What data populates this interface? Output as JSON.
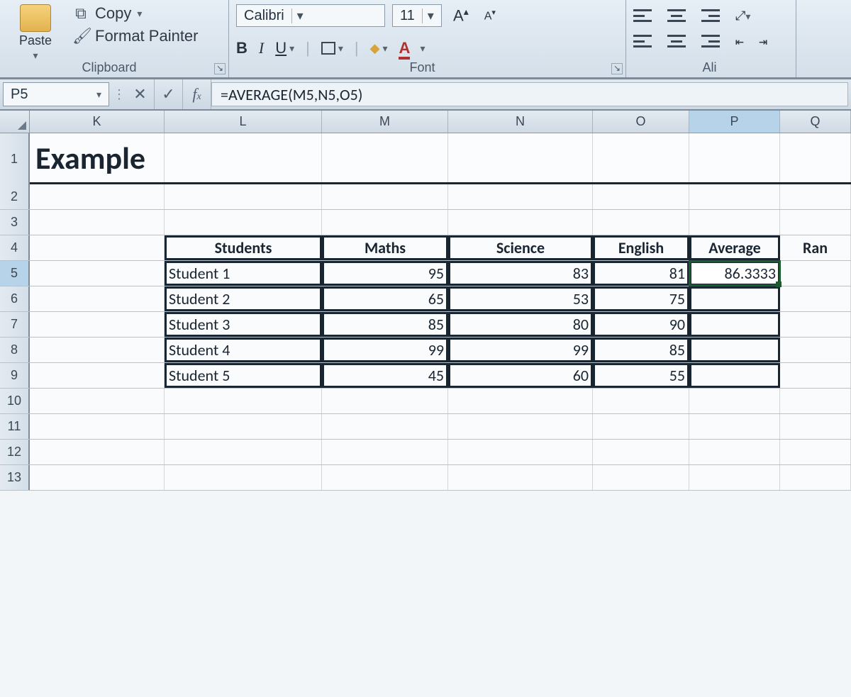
{
  "ribbon": {
    "paste_label": "Paste",
    "copy_label": "Copy",
    "format_painter_label": "Format Painter",
    "clipboard_group_label": "Clipboard",
    "font_name": "Calibri",
    "font_size": "11",
    "font_group_label": "Font",
    "alignment_group_label": "Ali"
  },
  "formula_bar": {
    "cell_ref": "P5",
    "formula": "=AVERAGE(M5,N5,O5)"
  },
  "columns": {
    "K": "K",
    "L": "L",
    "M": "M",
    "N": "N",
    "O": "O",
    "P": "P",
    "Q": "Q"
  },
  "rows": [
    "1",
    "2",
    "3",
    "4",
    "5",
    "6",
    "7",
    "8",
    "9",
    "10",
    "11",
    "12",
    "13"
  ],
  "sheet": {
    "title": "Example",
    "headers": {
      "students": "Students",
      "maths": "Maths",
      "science": "Science",
      "english": "English",
      "average": "Average",
      "rank": "Ran"
    },
    "data": [
      {
        "name": "Student 1",
        "m": "95",
        "s": "83",
        "e": "81",
        "avg": "86.3333"
      },
      {
        "name": "Student 2",
        "m": "65",
        "s": "53",
        "e": "75",
        "avg": ""
      },
      {
        "name": "Student 3",
        "m": "85",
        "s": "80",
        "e": "90",
        "avg": ""
      },
      {
        "name": "Student 4",
        "m": "99",
        "s": "99",
        "e": "85",
        "avg": ""
      },
      {
        "name": "Student 5",
        "m": "45",
        "s": "60",
        "e": "55",
        "avg": ""
      }
    ]
  },
  "chart_data": {
    "type": "table",
    "title": "Example",
    "columns": [
      "Students",
      "Maths",
      "Science",
      "English",
      "Average"
    ],
    "rows": [
      [
        "Student 1",
        95,
        83,
        81,
        86.3333
      ],
      [
        "Student 2",
        65,
        53,
        75,
        null
      ],
      [
        "Student 3",
        85,
        80,
        90,
        null
      ],
      [
        "Student 4",
        99,
        99,
        85,
        null
      ],
      [
        "Student 5",
        45,
        60,
        55,
        null
      ]
    ]
  }
}
